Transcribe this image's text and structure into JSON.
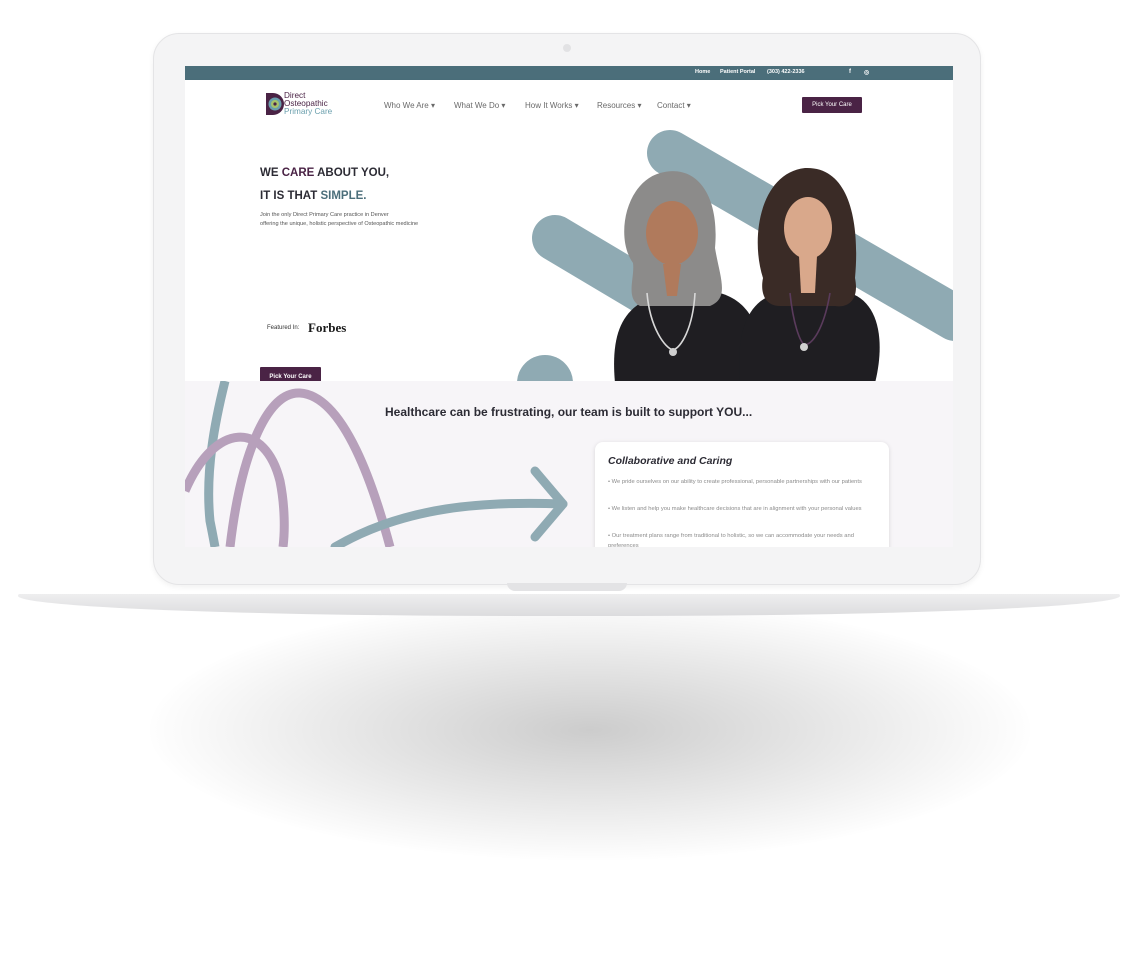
{
  "topbar": {
    "links": [
      "Home",
      "Patient Portal",
      "(303) 422-2336"
    ],
    "social": [
      "f",
      "◎"
    ]
  },
  "logo": {
    "line1": "Direct",
    "line2": "Osteopathic",
    "line3": "Primary Care"
  },
  "nav": {
    "items": [
      "Who We Are ▾",
      "What We Do ▾",
      "How It Works ▾",
      "Resources ▾",
      "Contact ▾"
    ],
    "cta": "Pick Your Care"
  },
  "hero": {
    "line1_a": "WE ",
    "line1_b": "CARE",
    "line1_c": " ABOUT YOU,",
    "line2_a": "IT IS THAT ",
    "line2_b": "SIMPLE.",
    "sub1": "Join the only Direct Primary Care practice in Denver",
    "sub2": "offering the unique, holistic perspective of Osteopathic medicine",
    "featured": "Featured In:",
    "forbes": "Forbes",
    "cta": "Pick Your Care"
  },
  "band": {
    "title": "Healthcare can be frustrating, our team is built to support YOU...",
    "card": {
      "title": "Collaborative and Caring",
      "b1": "• We pride ourselves on our ability to create professional, personable partnerships with our patients",
      "b2": "• We listen and help you make healthcare decisions that are in alignment with your personal values",
      "b3": "• Our treatment plans range from traditional to holistic, so we can accommodate your needs and preferences"
    }
  },
  "colors": {
    "brand_purple": "#4a2345",
    "brand_teal": "#4b6e7a",
    "art_teal": "#8faab3",
    "art_lilac": "#b7a0bb"
  }
}
